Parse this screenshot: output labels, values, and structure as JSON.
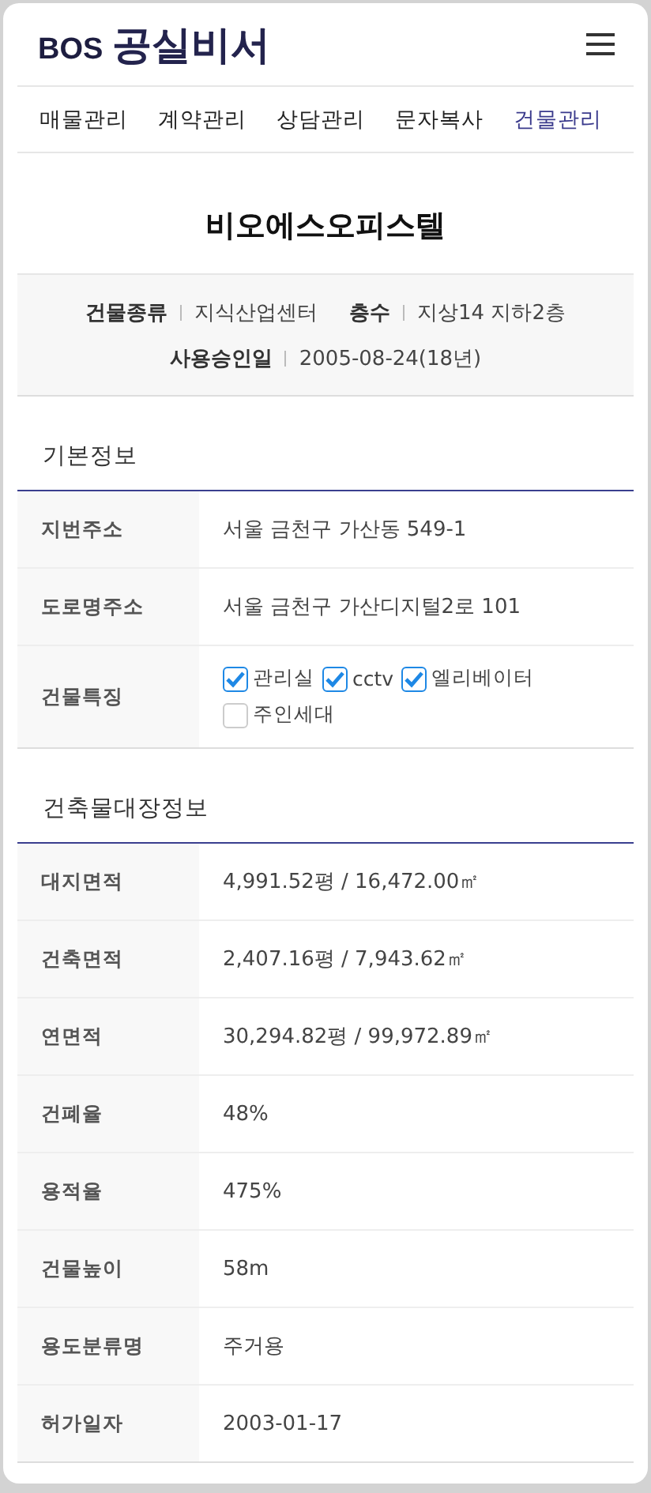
{
  "header": {
    "logo_prefix": "BOS",
    "logo_name": "공실비서"
  },
  "tabs": [
    {
      "label": "매물관리",
      "selected": false
    },
    {
      "label": "계약관리",
      "selected": false
    },
    {
      "label": "상담관리",
      "selected": false
    },
    {
      "label": "문자복사",
      "selected": false
    },
    {
      "label": "건물관리",
      "selected": true
    }
  ],
  "building": {
    "name": "비오에스오피스텔",
    "summary": [
      [
        {
          "label": "건물종류",
          "value": "지식산업센터"
        },
        {
          "label": "층수",
          "value": "지상14 지하2층"
        }
      ],
      [
        {
          "label": "사용승인일",
          "value": "2005-08-24(18년)"
        }
      ]
    ]
  },
  "sections": [
    {
      "title": "기본정보",
      "rows": [
        {
          "kind": "text",
          "label": "지번주소",
          "value": "서울 금천구 가산동 549-1"
        },
        {
          "kind": "text",
          "label": "도로명주소",
          "value": "서울 금천구 가산디지털2로 101"
        },
        {
          "kind": "checks",
          "label": "건물특징",
          "options": [
            {
              "label": "관리실",
              "checked": true
            },
            {
              "label": "cctv",
              "checked": true
            },
            {
              "label": "엘리베이터",
              "checked": true
            },
            {
              "label": "주인세대",
              "checked": false
            }
          ]
        }
      ]
    },
    {
      "title": "건축물대장정보",
      "rows": [
        {
          "kind": "text",
          "label": "대지면적",
          "value": "4,991.52평 / 16,472.00㎡"
        },
        {
          "kind": "text",
          "label": "건축면적",
          "value": "2,407.16평 / 7,943.62㎡"
        },
        {
          "kind": "text",
          "label": "연면적",
          "value": "30,294.82평 / 99,972.89㎡"
        },
        {
          "kind": "text",
          "label": "건폐율",
          "value": "48%"
        },
        {
          "kind": "text",
          "label": "용적율",
          "value": "475%"
        },
        {
          "kind": "text",
          "label": "건물높이",
          "value": "58m"
        },
        {
          "kind": "text",
          "label": "용도분류명",
          "value": "주거용"
        },
        {
          "kind": "text",
          "label": "허가일자",
          "value": "2003-01-17"
        }
      ]
    }
  ]
}
